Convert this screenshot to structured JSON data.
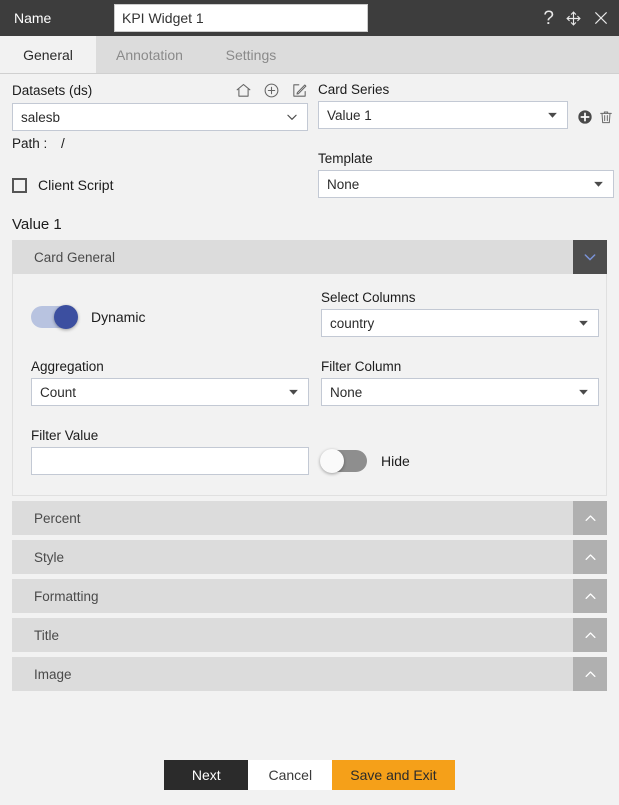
{
  "titlebar": {
    "label": "Name",
    "name_value": "KPI Widget 1",
    "name_placeholder": "",
    "help_icon": "question-mark-icon",
    "move_icon": "move-icon",
    "close_icon": "close-icon"
  },
  "tabs": [
    {
      "label": "General",
      "active": true
    },
    {
      "label": "Annotation",
      "active": false
    },
    {
      "label": "Settings",
      "active": false
    }
  ],
  "datasets": {
    "label": "Datasets (ds)",
    "value": "salesb",
    "home_icon": "home-icon",
    "add_icon": "add-circle-icon",
    "edit_icon": "edit-icon",
    "path_label": "Path :",
    "path_value": "/"
  },
  "card_series": {
    "label": "Card Series",
    "value": "Value 1",
    "add_icon": "add-circle-filled-icon",
    "delete_icon": "trash-icon"
  },
  "client_script": {
    "label": "Client Script",
    "checked": false
  },
  "template": {
    "label": "Template",
    "value": "None"
  },
  "value_section": {
    "title": "Value 1"
  },
  "card_general": {
    "title": "Card General",
    "expanded": true,
    "chevron_icon": "chevron-down-icon",
    "dynamic": {
      "label": "Dynamic",
      "on": true
    },
    "select_columns": {
      "label": "Select Columns",
      "value": "country"
    },
    "aggregation": {
      "label": "Aggregation",
      "value": "Count"
    },
    "filter_column": {
      "label": "Filter Column",
      "value": "None"
    },
    "filter_value": {
      "label": "Filter Value",
      "value": "",
      "placeholder": ""
    },
    "hide": {
      "label": "Hide",
      "on": false
    }
  },
  "sections": [
    {
      "title": "Percent",
      "chevron_icon": "chevron-up-icon"
    },
    {
      "title": "Style",
      "chevron_icon": "chevron-up-icon"
    },
    {
      "title": "Formatting",
      "chevron_icon": "chevron-up-icon"
    },
    {
      "title": "Title",
      "chevron_icon": "chevron-up-icon"
    },
    {
      "title": "Image",
      "chevron_icon": "chevron-up-icon"
    }
  ],
  "footer": {
    "next_label": "Next",
    "cancel_label": "Cancel",
    "save_label": "Save and Exit"
  },
  "colors": {
    "titlebar": "#3d3d3d",
    "accent_orange": "#f5a019",
    "toggle_on": "#3c4fa0",
    "panel_header": "#dcdcdc"
  }
}
